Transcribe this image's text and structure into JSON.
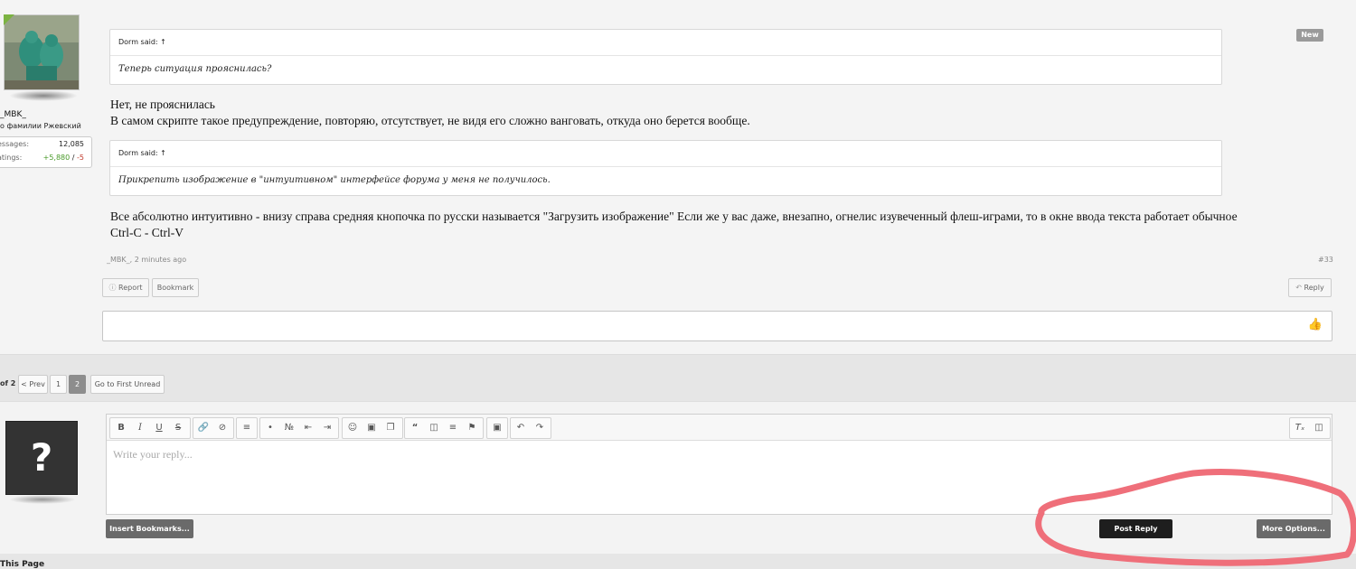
{
  "post": {
    "new_badge": "New",
    "user": {
      "name": "_MBK_",
      "title": "о фамилии Ржевский",
      "stats": [
        {
          "label": "essages:",
          "value": "12,085"
        },
        {
          "label": "atings:",
          "value_pos": "+5,880",
          "sep": " / ",
          "value_neg": "-5"
        }
      ]
    },
    "quotes": [
      {
        "author": "Dorm said: ↑",
        "text": "Теперь ситуация прояснилась?"
      },
      {
        "author": "Dorm said: ↑",
        "text": "Прикрепить изображение в \"интуитивном\" интерфейсе форума у меня не получилось."
      }
    ],
    "body_1_line1": "Нет, не прояснилась",
    "body_1_line2": "В самом скрипте такое предупреждение, повторяю, отсутствует, не видя его сложно вангoвать, откуда оно берется вообще.",
    "body_2_line1": "Все абсолютно интуитивно - внизу справа средняя кнопочка по русски называется \"Загрузить изображение\" Если же у вас даже, внезапно, огнелис изувеченный флеш-играми, то в окне ввода текста работает обычное",
    "body_2_line2": "Ctrl-C - Ctrl-V",
    "meta": "_MBK_, 2 minutes ago",
    "post_number": "#33",
    "actions": {
      "report": "Report",
      "bookmark": "Bookmark",
      "reply": "Reply"
    }
  },
  "pagination": {
    "prefix": "of 2",
    "prev": "< Prev",
    "pages": [
      "1",
      "2"
    ],
    "current": "2",
    "first_unread": "Go to First Unread"
  },
  "reply": {
    "guest_avatar": "?",
    "placeholder": "Write your reply...",
    "toolbar": [
      "B",
      "I",
      "U",
      "S"
    ],
    "insert_bookmarks": "Insert Bookmarks...",
    "post_reply": "Post Reply",
    "more_options": "More Options..."
  },
  "footer": {
    "text": "This Page"
  },
  "colors": {
    "annotation": "#ef6f7a",
    "accent_positive": "#4a9a2a",
    "accent_negative": "#c0392b"
  }
}
